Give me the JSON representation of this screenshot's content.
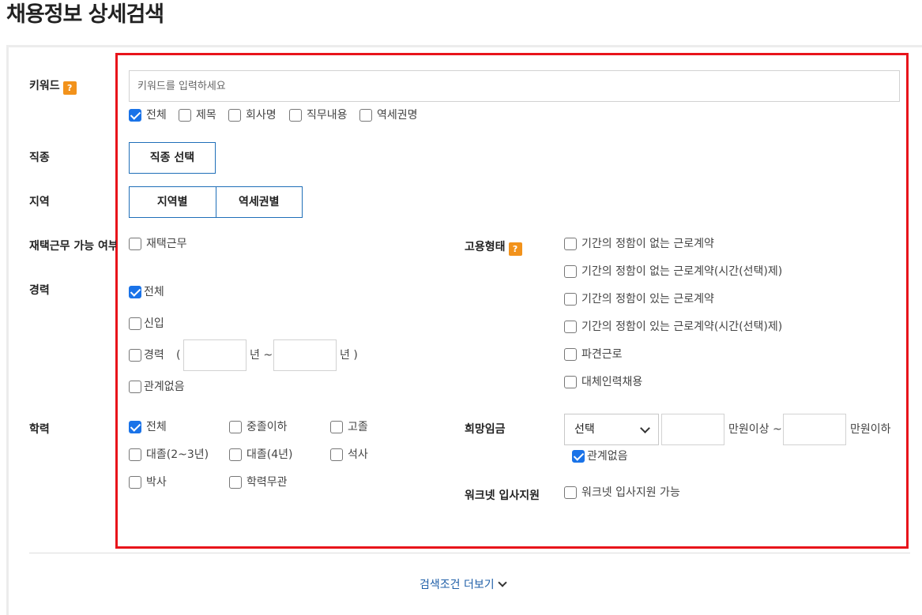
{
  "page_title": "채용정보 상세검색",
  "keyword": {
    "label": "키워드",
    "help": "?",
    "placeholder": "키워드를 입력하세요",
    "scopes": [
      {
        "label": "전체",
        "checked": true
      },
      {
        "label": "제목",
        "checked": false
      },
      {
        "label": "회사명",
        "checked": false
      },
      {
        "label": "직무내용",
        "checked": false
      },
      {
        "label": "역세권명",
        "checked": false
      }
    ]
  },
  "job_type": {
    "label": "직종",
    "button": "직종 선택"
  },
  "region": {
    "label": "지역",
    "buttons": [
      "지역별",
      "역세권별"
    ]
  },
  "remote": {
    "label": "재택근무 가능 여부",
    "option": "재택근무"
  },
  "career": {
    "label": "경력",
    "options": [
      "전체",
      "신입",
      "경력",
      "관계없음"
    ],
    "open_paren": "(",
    "year_from": "년 ~",
    "year_to": "년 )"
  },
  "education": {
    "label": "학력",
    "options": [
      "전체",
      "중졸이하",
      "고졸",
      "대졸(2~3년)",
      "대졸(4년)",
      "석사",
      "박사",
      "학력무관"
    ]
  },
  "employment": {
    "label": "고용형태",
    "help": "?",
    "options": [
      "기간의 정함이 없는 근로계약",
      "기간의 정함이 없는 근로계약(시간(선택)제)",
      "기간의 정함이 있는 근로계약",
      "기간의 정함이 있는 근로계약(시간(선택)제)",
      "파견근로",
      "대체인력채용"
    ]
  },
  "salary": {
    "label": "희망임금",
    "select_value": "선택",
    "min_suffix": "만원이상 ~",
    "max_suffix": "만원이하",
    "any": "관계없음"
  },
  "worknet": {
    "label": "워크넷 입사지원",
    "option": "워크넷 입사지원 가능"
  },
  "more_conditions": "검색조건 더보기",
  "colors": {
    "accent": "#1a73e8",
    "outline": "#e8141b",
    "help": "#f2921b",
    "link": "#1f5fa8"
  }
}
